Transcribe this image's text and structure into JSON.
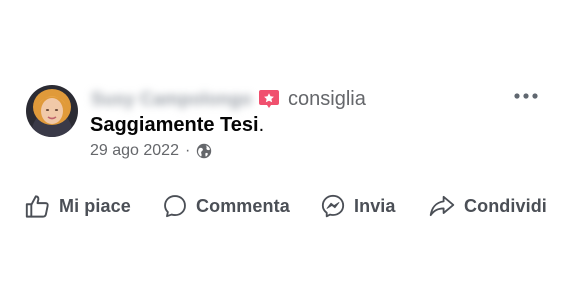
{
  "post": {
    "author_name": "Susy Campolongo",
    "action": "consiglia",
    "review_text": "Saggiamente Tesi",
    "review_punct": ".",
    "date": "29 ago 2022",
    "separator": "·",
    "privacy_icon": "globe-icon",
    "badge_icon": "recommend-star-icon",
    "more_icon": "more-options-icon"
  },
  "actions": {
    "like": {
      "label": "Mi piace",
      "icon": "thumbs-up-icon"
    },
    "comment": {
      "label": "Commenta",
      "icon": "comment-icon"
    },
    "send": {
      "label": "Invia",
      "icon": "messenger-icon"
    },
    "share": {
      "label": "Condividi",
      "icon": "share-icon"
    }
  },
  "colors": {
    "badge": "#f0506e",
    "secondary_text": "#65676b",
    "primary_text": "#050505"
  }
}
